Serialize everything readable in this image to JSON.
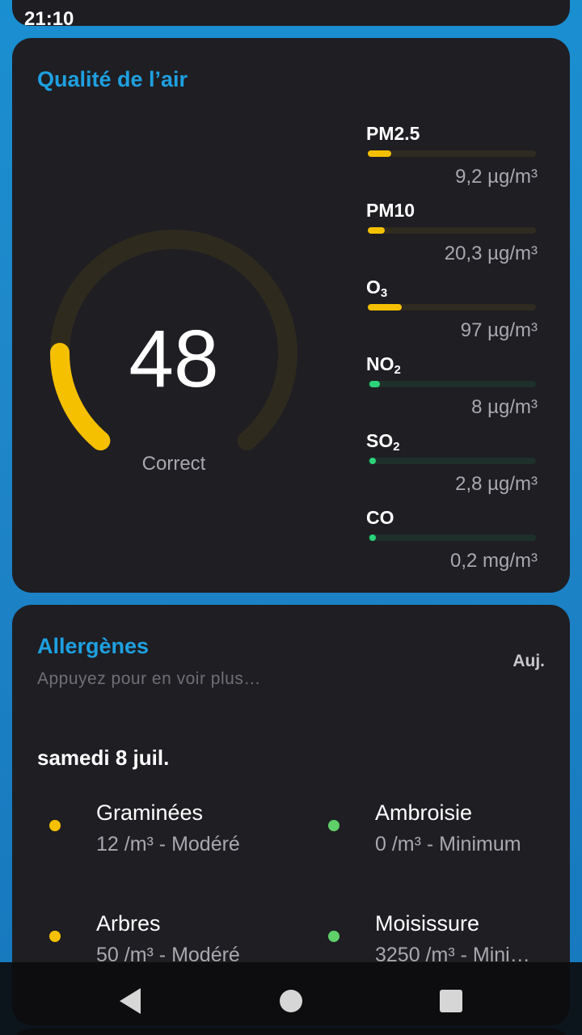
{
  "status_bar": {
    "time": "21:10"
  },
  "air_quality": {
    "title": "Qualité de l’air",
    "index": "48",
    "index_value": 48,
    "index_label": "Correct",
    "gauge_fill_fraction": 0.18,
    "gauge_color": "#f5c000",
    "gauge_track_color": "#2e2a1e",
    "pollutants": [
      {
        "name": "PM2.5",
        "sub": "",
        "value": "9,2 µg/m³",
        "fill": 0.14,
        "color": "#f5c000",
        "track": "#2f2b20"
      },
      {
        "name": "PM10",
        "sub": "",
        "value": "20,3 µg/m³",
        "fill": 0.1,
        "color": "#f5c000",
        "track": "#2f2b20"
      },
      {
        "name": "O",
        "sub": "3",
        "value": "97 µg/m³",
        "fill": 0.2,
        "color": "#f5c000",
        "track": "#2f2b20"
      },
      {
        "name": "NO",
        "sub": "2",
        "value": "8 µg/m³",
        "fill": 0.03,
        "color": "#2bd47a",
        "track": "#1d302a"
      },
      {
        "name": "SO",
        "sub": "2",
        "value": "2,8 µg/m³",
        "fill": 0.01,
        "color": "#2bd47a",
        "track": "#1d302a"
      },
      {
        "name": "CO",
        "sub": "",
        "value": "0,2 mg/m³",
        "fill": 0.01,
        "color": "#2bd47a",
        "track": "#1d302a"
      }
    ]
  },
  "allergens": {
    "title": "Allergènes",
    "subtitle": "Appuyez pour en voir plus…",
    "period": "Auj.",
    "date": "samedi 8 juil.",
    "items": [
      {
        "name": "Graminées",
        "detail": "12 /m³ - Modéré",
        "color": "#f5c000"
      },
      {
        "name": "Ambroisie",
        "detail": "0 /m³ - Minimum",
        "color": "#5fcf6a"
      },
      {
        "name": "Arbres",
        "detail": "50 /m³ - Modéré",
        "color": "#f5c000"
      },
      {
        "name": "Moisissure",
        "detail": "3250 /m³ - Mini…",
        "color": "#5fcf6a"
      }
    ]
  },
  "nav": {
    "back": "back-icon",
    "home": "home-icon",
    "recents": "recents-icon"
  }
}
